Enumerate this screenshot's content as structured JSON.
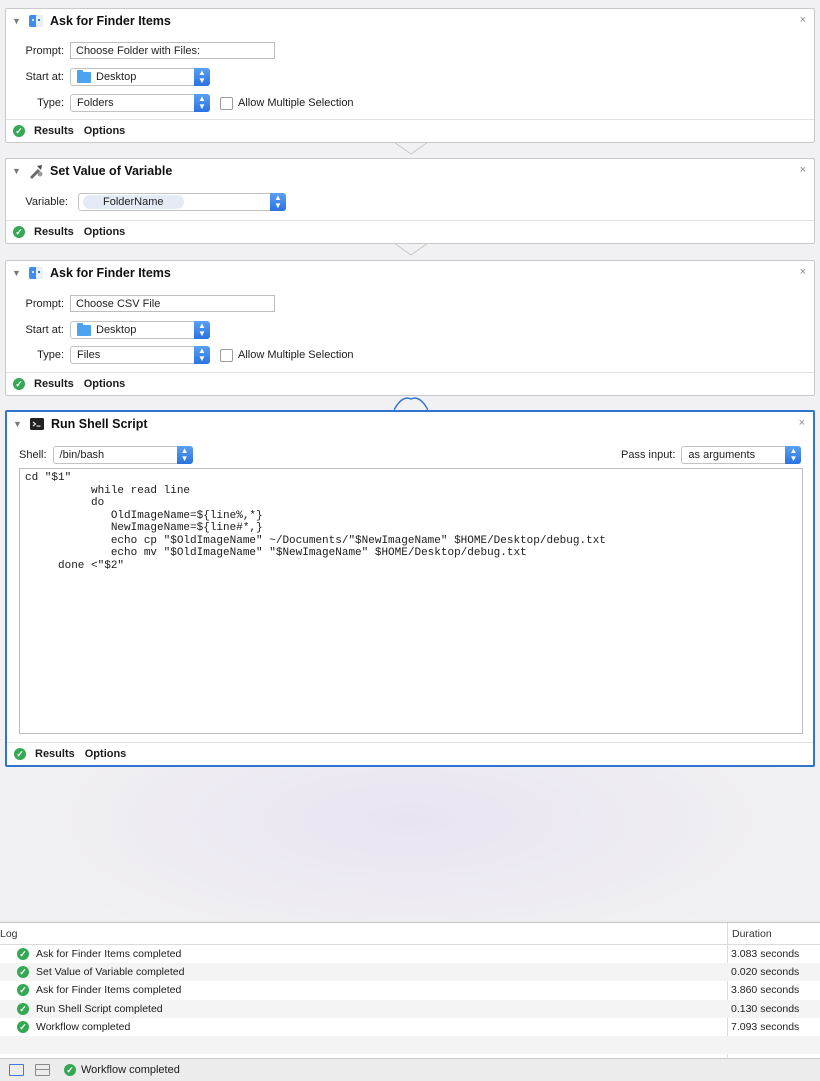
{
  "actions": [
    {
      "title": "Ask for Finder Items",
      "icon": "finder-icon",
      "prompt_label": "Prompt:",
      "prompt_value": "Choose Folder with Files:",
      "start_label": "Start at:",
      "start_value": "Desktop",
      "type_label": "Type:",
      "type_value": "Folders",
      "allow_multiple": "Allow Multiple Selection",
      "results": "Results",
      "options": "Options"
    },
    {
      "title": "Set Value of Variable",
      "icon": "variable-icon",
      "variable_label": "Variable:",
      "variable_value": "FolderName",
      "results": "Results",
      "options": "Options"
    },
    {
      "title": "Ask for Finder Items",
      "icon": "finder-icon",
      "prompt_label": "Prompt:",
      "prompt_value": "Choose CSV File",
      "start_label": "Start at:",
      "start_value": "Desktop",
      "type_label": "Type:",
      "type_value": "Files",
      "allow_multiple": "Allow Multiple Selection",
      "results": "Results",
      "options": "Options"
    },
    {
      "title": "Run Shell Script",
      "icon": "terminal-icon",
      "shell_label": "Shell:",
      "shell_value": "/bin/bash",
      "pass_input_label": "Pass input:",
      "pass_input_value": "as arguments",
      "script": "cd \"$1\"\n          while read line\n          do\n             OldImageName=${line%,*}\n             NewImageName=${line#*,}\n             echo cp \"$OldImageName\" ~/Documents/\"$NewImageName\" $HOME/Desktop/debug.txt\n             echo mv \"$OldImageName\" \"$NewImageName\" $HOME/Desktop/debug.txt\n     done <\"$2\"",
      "results": "Results",
      "options": "Options"
    }
  ],
  "close_glyph": "×",
  "log": {
    "header": "Log",
    "duration_header": "Duration",
    "rows": [
      {
        "text": "Ask for Finder Items completed",
        "duration": "3.083 seconds"
      },
      {
        "text": "Set Value of Variable completed",
        "duration": "0.020 seconds"
      },
      {
        "text": "Ask for Finder Items completed",
        "duration": "3.860 seconds"
      },
      {
        "text": "Run Shell Script completed",
        "duration": "0.130 seconds"
      },
      {
        "text": "Workflow completed",
        "duration": "7.093 seconds"
      }
    ]
  },
  "status_bar": {
    "status": "Workflow completed"
  },
  "colors": {
    "accent": "#2f74d0",
    "success": "#34a853",
    "folder": "#4da3ef"
  }
}
